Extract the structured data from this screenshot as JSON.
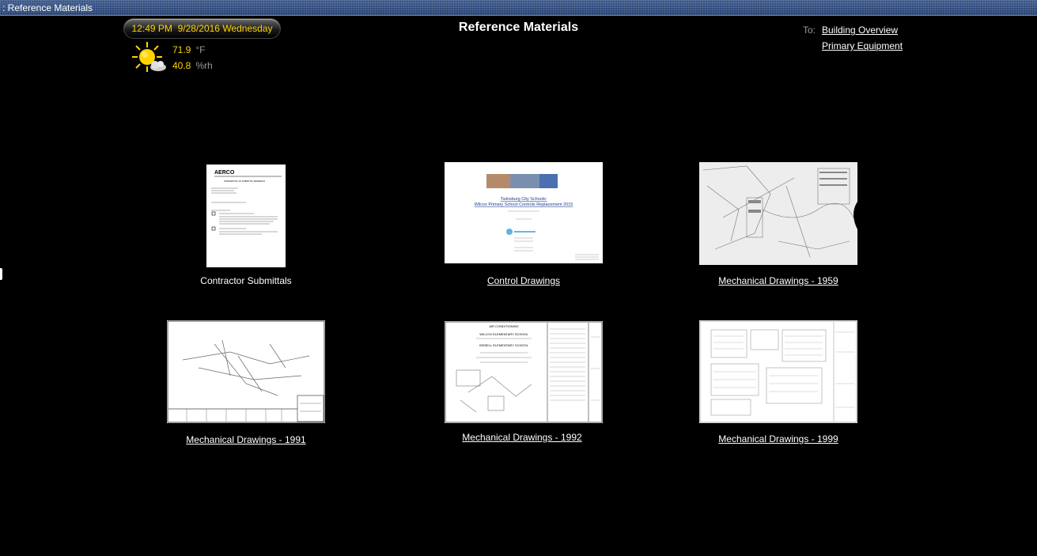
{
  "window": {
    "title": ": Reference Materials"
  },
  "clock": {
    "time": "12:49 PM",
    "date": "9/28/2016",
    "day": "Wednesday"
  },
  "weather": {
    "icon": "partly-sunny-icon",
    "temperature": {
      "value": "71.9",
      "unit": "°F"
    },
    "humidity": {
      "value": "40.8",
      "unit": "%rh"
    }
  },
  "page": {
    "title": "Reference Materials"
  },
  "nav": {
    "to_label": "To:",
    "links": [
      "Building Overview",
      "Primary Equipment"
    ]
  },
  "documents": [
    {
      "label": "Contractor Submittals",
      "is_link": false,
      "thumb_text": {
        "logo": "AERCO",
        "heading": "TRANSMITTAL OF SUBMITTAL DRAWINGS"
      }
    },
    {
      "label": "Control Drawings",
      "is_link": true,
      "thumb_text": {
        "line1": "Twinsburg City Schools:",
        "line2": "Wilcox Primary School Controls Replacement 2015"
      }
    },
    {
      "label": "Mechanical Drawings - 1959",
      "is_link": true,
      "thumb_text": {}
    },
    {
      "label": "Mechanical Drawings - 1991",
      "is_link": true,
      "thumb_text": {}
    },
    {
      "label": "Mechanical Drawings - 1992",
      "is_link": true,
      "thumb_text": {
        "line1": "AIR CONDITIONING",
        "line2": "WILCOX ELEMENTARY SCHOOL",
        "line3": "BISSELL ELEMENTARY SCHOOL"
      }
    },
    {
      "label": "Mechanical Drawings - 1999",
      "is_link": true,
      "thumb_text": {}
    }
  ],
  "colors": {
    "accent_yellow": "#ffd400",
    "label_gray": "#9a9a9a",
    "background": "#000000"
  }
}
